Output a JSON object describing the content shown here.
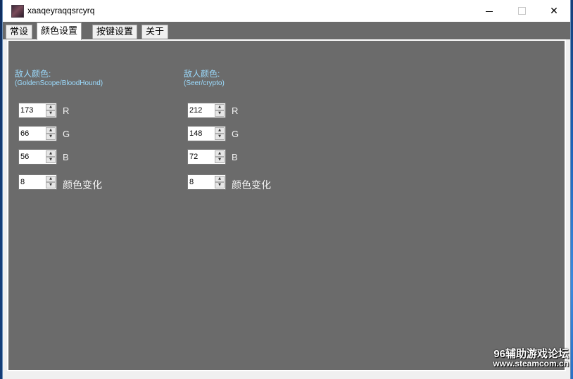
{
  "window": {
    "title": "xaaqeyraqqsrcyrq",
    "minimize_icon": "minimize-icon",
    "maximize_icon": "maximize-icon",
    "close_icon": "close-icon",
    "close_glyph": "✕"
  },
  "tabs": [
    {
      "label": "常设",
      "active": false
    },
    {
      "label": "颜色设置",
      "active": true
    },
    {
      "label": "按键设置",
      "active": false
    },
    {
      "label": "关于",
      "active": false
    }
  ],
  "groups": [
    {
      "title": "敌人颜色:",
      "subtitle": "(GoldenScope/BloodHound)",
      "fields": [
        {
          "value": "173",
          "label": "R"
        },
        {
          "value": "66",
          "label": "G"
        },
        {
          "value": "56",
          "label": "B"
        },
        {
          "value": "8",
          "label": "颜色变化"
        }
      ]
    },
    {
      "title": "敌人颜色:",
      "subtitle": "(Seer/crypto)",
      "fields": [
        {
          "value": "212",
          "label": "R"
        },
        {
          "value": "148",
          "label": "G"
        },
        {
          "value": "72",
          "label": "B"
        },
        {
          "value": "8",
          "label": "颜色变化"
        }
      ]
    }
  ],
  "spinner": {
    "up_glyph": "▲",
    "down_glyph": "▼"
  },
  "watermark": {
    "line1": "96辅助游戏论坛",
    "line2": "www.steamcom.cn"
  },
  "colors": {
    "panel": "#6b6b6b",
    "group_title": "#9cdcff",
    "tabstrip": "#6a6a6a"
  }
}
